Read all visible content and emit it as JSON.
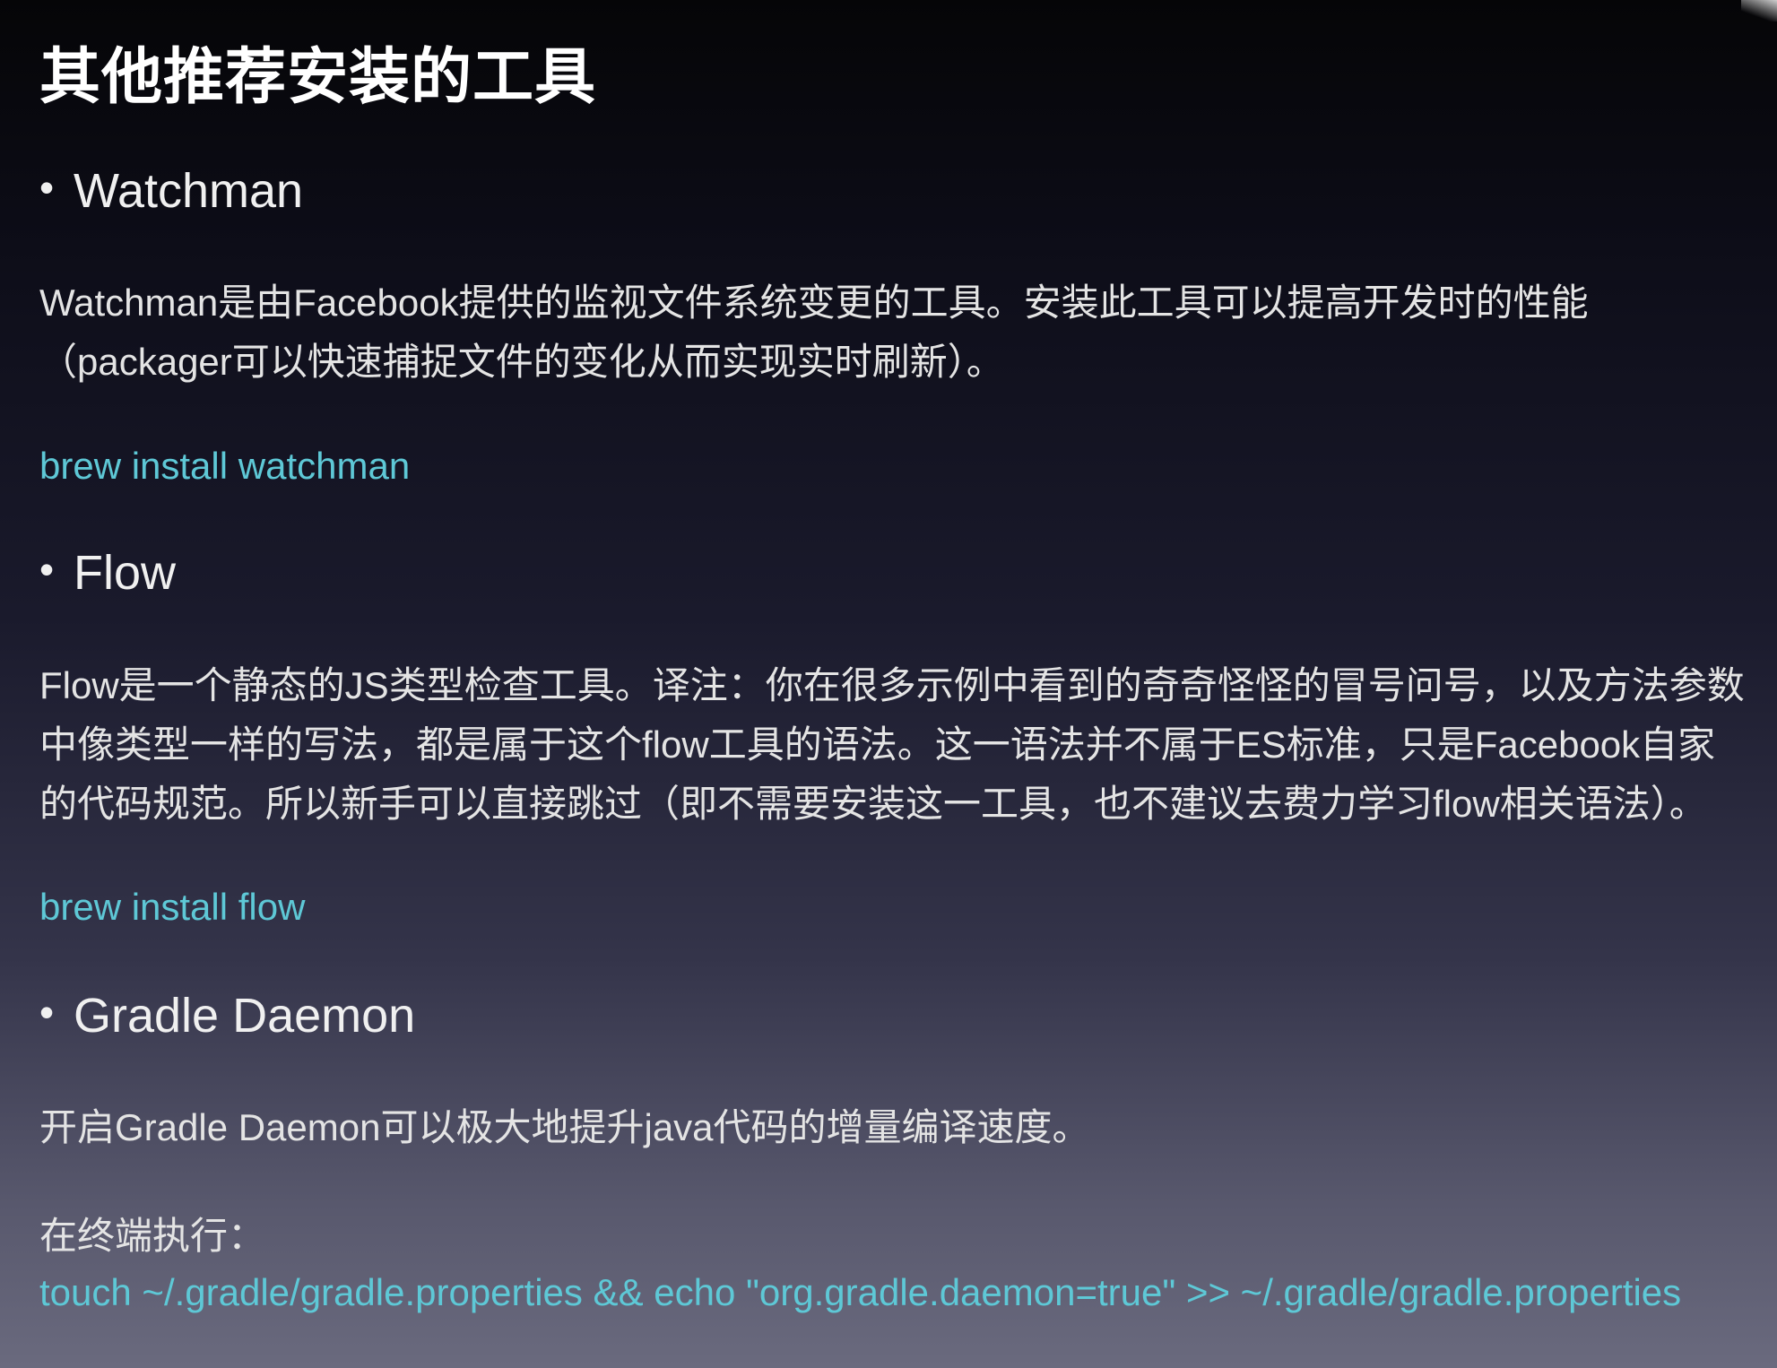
{
  "title": "其他推荐安装的工具",
  "sections": [
    {
      "bullet": "•",
      "heading": "Watchman",
      "description_lines": [
        "Watchman是由Facebook提供的监视文件系统变更的工具。安装此工具可以提高开发时的性能",
        "（packager可以快速捕捉文件的变化从而实现实时刷新）。"
      ],
      "command": "brew install watchman"
    },
    {
      "bullet": "•",
      "heading": "Flow",
      "description_lines": [
        "Flow是一个静态的JS类型检查工具。译注：你在很多示例中看到的奇奇怪怪的冒号问号，以及方法参数",
        "中像类型一样的写法，都是属于这个flow工具的语法。这一语法并不属于ES标准，只是Facebook自家",
        "的代码规范。所以新手可以直接跳过（即不需要安装这一工具，也不建议去费力学习flow相关语法）。"
      ],
      "command": "brew install flow"
    },
    {
      "bullet": "•",
      "heading": "Gradle Daemon",
      "description_lines": [
        "开启Gradle Daemon可以极大地提升java代码的增量编译速度。"
      ],
      "terminal_label": "在终端执行：",
      "command": "touch ~/.gradle/gradle.properties && echo \"org.gradle.daemon=true\" >> ~/.gradle/gradle.properties"
    }
  ]
}
